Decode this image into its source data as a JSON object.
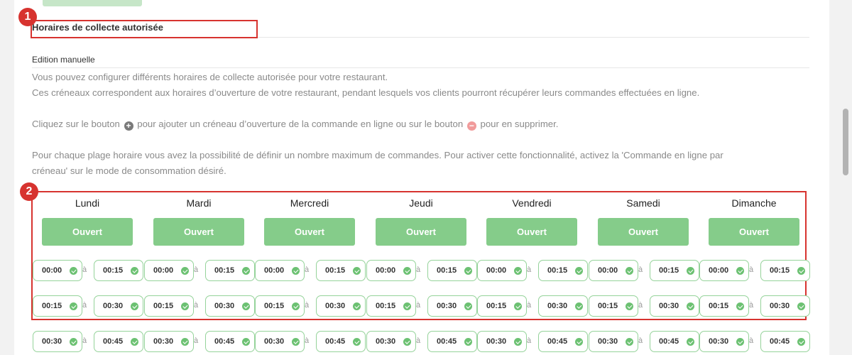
{
  "section_title": "Horaires de collecte autorisée",
  "subsection_title": "Edition manuelle",
  "description": {
    "line1": "Vous pouvez configurer différents horaires de collecte autorisée pour votre restaurant.",
    "line2": "Ces créneaux correspondent aux horaires d’ouverture de votre restaurant, pendant lesquels vos clients pourront récupérer leurs commandes effectuées en ligne.",
    "line3_before_add": "Cliquez sur le bouton",
    "line3_between": "pour ajouter un créneau d’ouverture de la commande en ligne ou sur le bouton",
    "line3_after_remove": "pour en supprimer.",
    "line4": "Pour chaque plage horaire vous avez la possibilité de définir un nombre maximum de commandes. Pour activer cette fonctionnalité, activez la 'Commande en ligne par",
    "line5": "créneau' sur le mode de consommation désiré."
  },
  "icons": {
    "add": "plus-circle-icon",
    "remove": "minus-circle-icon",
    "field_valid": "check-circle-icon",
    "add_glyph": "+",
    "remove_glyph": "−"
  },
  "annotations": {
    "badge1": "1",
    "badge2": "2"
  },
  "days": [
    {
      "name": "Lundi",
      "status": "Ouvert"
    },
    {
      "name": "Mardi",
      "status": "Ouvert"
    },
    {
      "name": "Mercredi",
      "status": "Ouvert"
    },
    {
      "name": "Jeudi",
      "status": "Ouvert"
    },
    {
      "name": "Vendredi",
      "status": "Ouvert"
    },
    {
      "name": "Samedi",
      "status": "Ouvert"
    },
    {
      "name": "Dimanche",
      "status": "Ouvert"
    }
  ],
  "time_separator": "à",
  "slots": [
    {
      "start": "00:00",
      "end": "00:15"
    },
    {
      "start": "00:15",
      "end": "00:30"
    },
    {
      "start": "00:30",
      "end": "00:45"
    }
  ],
  "colors": {
    "open_button": "#85cc8a",
    "field_border": "#95d39a",
    "check": "#6cc172",
    "annotation": "#d7332f"
  }
}
